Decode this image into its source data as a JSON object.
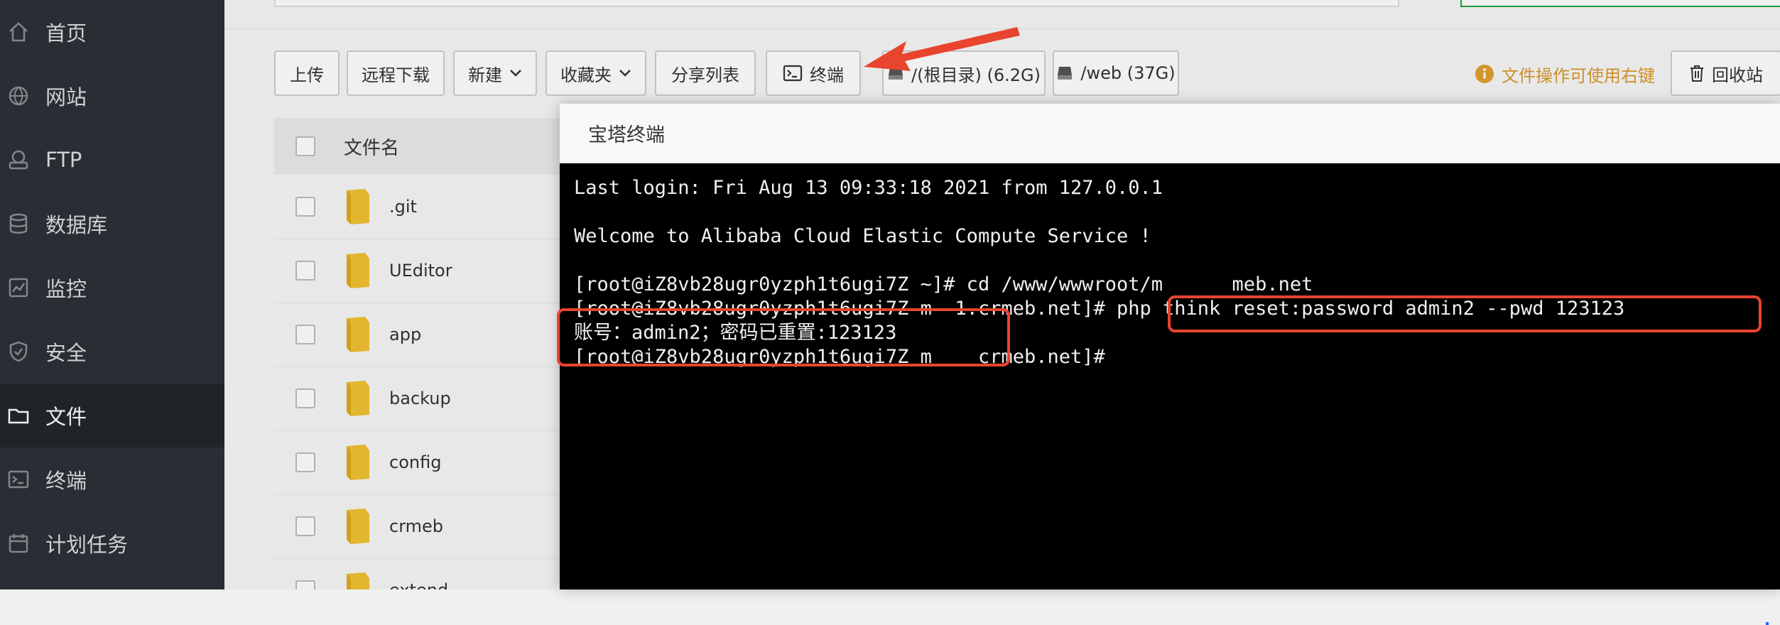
{
  "sidebar": {
    "items": [
      {
        "label": "首页",
        "icon": "home-icon",
        "active": false
      },
      {
        "label": "网站",
        "icon": "globe-icon",
        "active": false
      },
      {
        "label": "FTP",
        "icon": "ftp-icon",
        "active": false
      },
      {
        "label": "数据库",
        "icon": "database-icon",
        "active": false
      },
      {
        "label": "监控",
        "icon": "monitor-icon",
        "active": false
      },
      {
        "label": "安全",
        "icon": "shield-icon",
        "active": false
      },
      {
        "label": "文件",
        "icon": "folder-icon",
        "active": true
      },
      {
        "label": "终端",
        "icon": "terminal-icon",
        "active": false
      },
      {
        "label": "计划任务",
        "icon": "calendar-icon",
        "active": false
      }
    ]
  },
  "toolbar": {
    "upload": "上传",
    "remote_download": "远程下载",
    "new": "新建",
    "favorites": "收藏夹",
    "share_list": "分享列表",
    "terminal": "终端",
    "disk_root": "/(根目录) (6.2G)",
    "disk_web": "/web (37G)",
    "hint": "文件操作可使用右键",
    "recycle_bin": "回收站"
  },
  "file_list": {
    "header_name": "文件名",
    "rows": [
      ".git",
      "UEditor",
      "app",
      "backup",
      "config",
      "crmeb",
      "extend"
    ]
  },
  "dialog": {
    "title": "宝塔终端",
    "lines": [
      "Last login: Fri Aug 13 09:33:18 2021 from 127.0.0.1",
      "",
      "Welcome to Alibaba Cloud Elastic Compute Service !",
      "",
      "[root@iZ8vb28ugr0yzph1t6ugi7Z ~]# cd /www/wwwroot/m      meb.net",
      "[root@iZ8vb28ugr0yzph1t6ugi7Z m  1.crmeb.net]# php think reset:password admin2 --pwd 123123",
      "账号：admin2；密码已重置:123123",
      "[root@iZ8vb28ugr0yzph1t6ugi7Z m    crmeb.net]#"
    ]
  },
  "colors": {
    "sidebar_bg": "#2c3138",
    "sidebar_active": "#23272c",
    "annotation_red": "#e8442e",
    "hint_orange": "#d99a2c",
    "terminal_bg": "#000000"
  }
}
